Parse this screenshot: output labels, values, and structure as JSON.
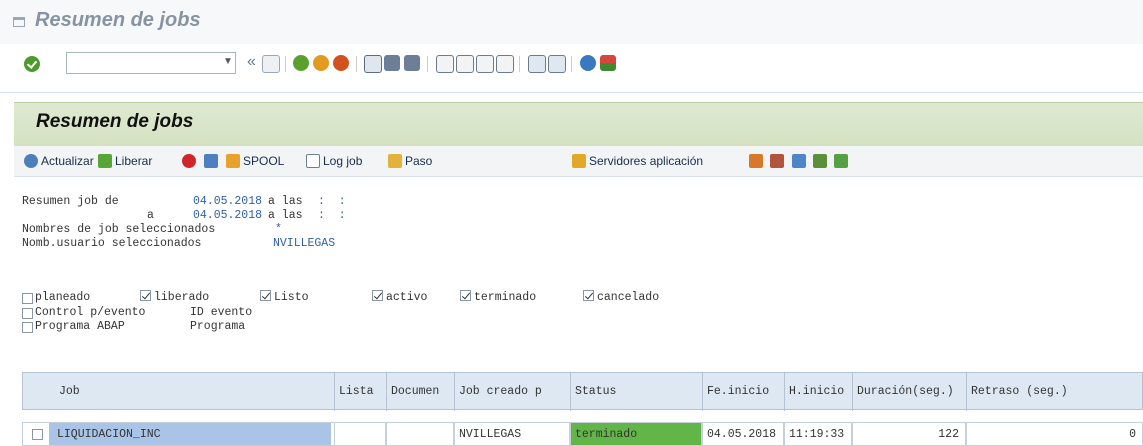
{
  "window": {
    "title": "Resumen de jobs"
  },
  "toolbar": {
    "command_value": "",
    "icons": [
      "ok-icon",
      "save-icon",
      "back-icon",
      "exit-icon",
      "cancel-icon",
      "print-icon",
      "find-icon",
      "find-next-icon",
      "first-page-icon",
      "previous-page-icon",
      "next-page-icon",
      "last-page-icon",
      "new-session-icon",
      "shortcut-icon",
      "help-icon",
      "customize-icon"
    ]
  },
  "panel": {
    "title": "Resumen de jobs",
    "buttons": {
      "actualizar": "Actualizar",
      "liberar": "Liberar",
      "spool": "SPOOL",
      "log_job": "Log job",
      "paso": "Paso",
      "servidores": "Servidores aplicación"
    }
  },
  "summary": {
    "line1_label": "Resumen job de",
    "line1_date": "04.05.2018",
    "line1_a_las": "a las",
    "line1_time": ":  :",
    "line2_a": "a",
    "line2_date": "04.05.2018",
    "line2_a_las": "a las",
    "line2_time": ":  :",
    "job_names_label": "Nombres de job seleccionados",
    "job_names_value": "*",
    "user_label": "Nomb.usuario seleccionados",
    "user_value": "NVILLEGAS"
  },
  "status_filters": [
    {
      "label": "planeado",
      "checked": false
    },
    {
      "label": "liberado",
      "checked": true
    },
    {
      "label": "Listo",
      "checked": true
    },
    {
      "label": "activo",
      "checked": true
    },
    {
      "label": "terminado",
      "checked": true
    },
    {
      "label": "cancelado",
      "checked": true
    }
  ],
  "event_filter": {
    "label": "Control p/evento",
    "id_label": "ID evento"
  },
  "abap_filter": {
    "label": "Programa ABAP",
    "prog_label": "Programa"
  },
  "table": {
    "headers": [
      "Job",
      "Lista",
      "Documen",
      "Job creado p",
      "Status",
      "Fe.inicio",
      "H.inicio",
      "Duración(seg.)",
      "Retraso (seg.)"
    ],
    "rows": [
      {
        "job": "LIQUIDACION_INC",
        "lista": "",
        "documen": "",
        "creado": "NVILLEGAS",
        "status": "terminado",
        "fecha": "04.05.2018",
        "hora": "11:19:33",
        "duracion": "122",
        "retraso": "0"
      }
    ]
  },
  "colors": {
    "status_done": "#62b648",
    "selected_job": "#aac4e8",
    "header_bg": "#dde8f3",
    "panel_head": "#d7e4c6"
  }
}
